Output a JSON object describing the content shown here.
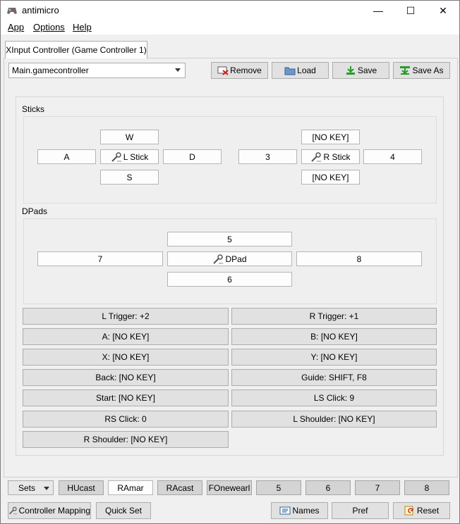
{
  "window": {
    "title": "antimicro",
    "minimize": "—",
    "maximize": "☐",
    "close": "✕"
  },
  "menu": {
    "app": "App",
    "options": "Options",
    "help": "Help"
  },
  "tab": {
    "label": "XInput Controller (Game Controller 1)"
  },
  "profile": {
    "value": "Main.gamecontroller",
    "remove": "Remove",
    "load": "Load",
    "save": "Save",
    "save_as": "Save As"
  },
  "sticks": {
    "label": "Sticks",
    "left": {
      "up": "W",
      "left": "A",
      "center": "L Stick",
      "right": "D",
      "down": "S"
    },
    "right": {
      "up": "[NO KEY]",
      "left": "3",
      "center": "R Stick",
      "right": "4",
      "down": "[NO KEY]"
    }
  },
  "dpads": {
    "label": "DPads",
    "up": "5",
    "left": "7",
    "center": "DPad",
    "right": "8",
    "down": "6"
  },
  "buttons": {
    "l_trigger": "L Trigger: +2",
    "r_trigger": "R Trigger: +1",
    "a": "A: [NO KEY]",
    "b": "B: [NO KEY]",
    "x": "X: [NO KEY]",
    "y": "Y: [NO KEY]",
    "back": "Back: [NO KEY]",
    "guide": "Guide: SHIFT, F8",
    "start": "Start: [NO KEY]",
    "ls_click": "LS Click: 9",
    "rs_click": "RS Click: 0",
    "l_shoulder": "L Shoulder: [NO KEY]",
    "r_shoulder": "R Shoulder: [NO KEY]"
  },
  "sets": {
    "label": "Sets",
    "items": [
      "HUcast",
      "RAmar",
      "RAcast",
      "FOnewearl",
      "5",
      "6",
      "7",
      "8"
    ]
  },
  "bottom": {
    "controller_mapping": "Controller Mapping",
    "quick_set": "Quick Set",
    "names": "Names",
    "pref": "Pref",
    "reset": "Reset"
  }
}
